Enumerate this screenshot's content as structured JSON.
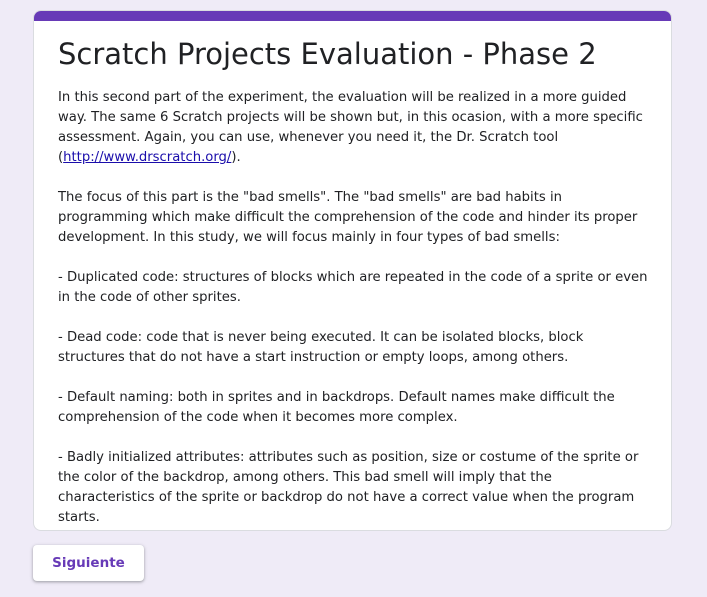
{
  "form": {
    "title": "Scratch Projects Evaluation - Phase 2",
    "intro": {
      "before_link": "In this second part of the experiment, the evaluation will be realized in a more guided way. The same 6 Scratch projects will be shown but, in this ocasion, with a more specific assessment. Again, you can use, whenever you need it, the Dr. Scratch tool (",
      "link_text": "http://www.drscratch.org/",
      "after_link": ")."
    },
    "paragraphs": [
      "The focus of this part is the \"bad smells\". The \"bad smells\" are bad habits in programming which make difficult the comprehension of the code and hinder its proper development. In this study, we will focus mainly in four types of bad smells:",
      "- Duplicated code: structures of blocks which are repeated in the code of a sprite or even in the code of other sprites.",
      "- Dead code: code that is never being executed. It can be isolated blocks, block structures that do not have a start instruction or empty loops, among others.",
      "- Default naming: both in sprites and in backdrops. Default names make difficult the comprehension of the code when it becomes more complex.",
      "- Badly initialized attributes: attributes such as position, size or costume of the sprite or the color of the backdrop, among others. This bad smell will imply that the characteristics of the sprite or backdrop do not have a correct value when the program starts."
    ],
    "next_button_label": "Siguiente"
  },
  "colors": {
    "accent": "#673ab7",
    "page_background": "#efebf7",
    "link": "#1a0dab"
  }
}
